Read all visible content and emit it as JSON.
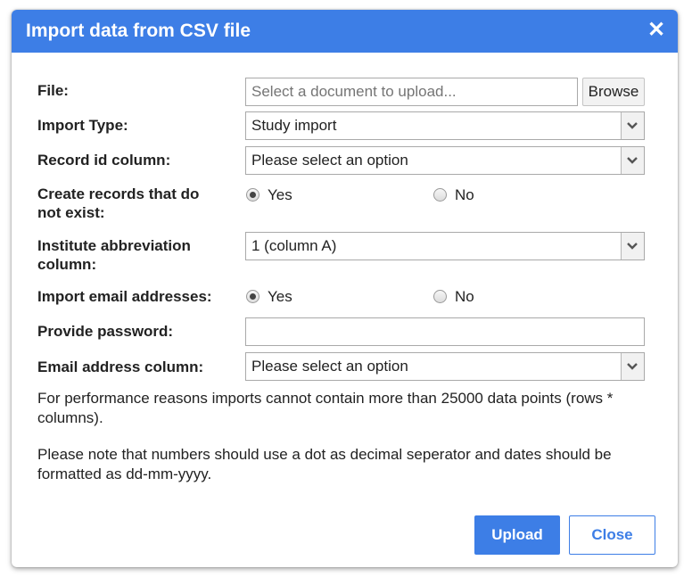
{
  "dialog": {
    "title": "Import data from CSV file",
    "close_icon": "close-icon",
    "close_glyph": "✕"
  },
  "form": {
    "file": {
      "label": "File:",
      "placeholder": "Select a document to upload...",
      "browse_label": "Browse"
    },
    "import_type": {
      "label": "Import Type:",
      "value": "Study import"
    },
    "record_id_column": {
      "label": "Record id column:",
      "value": "Please select an option"
    },
    "create_records": {
      "label": "Create records that do not exist:",
      "options": [
        "Yes",
        "No"
      ],
      "selected": "Yes"
    },
    "institute_column": {
      "label": "Institute abbreviation column:",
      "value": "1 (column A)"
    },
    "import_emails": {
      "label": "Import email addresses:",
      "options": [
        "Yes",
        "No"
      ],
      "selected": "Yes"
    },
    "password": {
      "label": "Provide password:",
      "value": ""
    },
    "email_column": {
      "label": "Email address column:",
      "value": "Please select an option"
    }
  },
  "notes": {
    "performance": "For performance reasons imports cannot contain more than 25000 data points (rows * columns).",
    "format": "Please note that numbers should use a dot as decimal seperator and dates should be formatted as dd-mm-yyyy."
  },
  "footer": {
    "upload_label": "Upload",
    "close_label": "Close"
  },
  "colors": {
    "accent": "#3d7ee6",
    "text": "#222222",
    "border": "#a9a9a9"
  }
}
